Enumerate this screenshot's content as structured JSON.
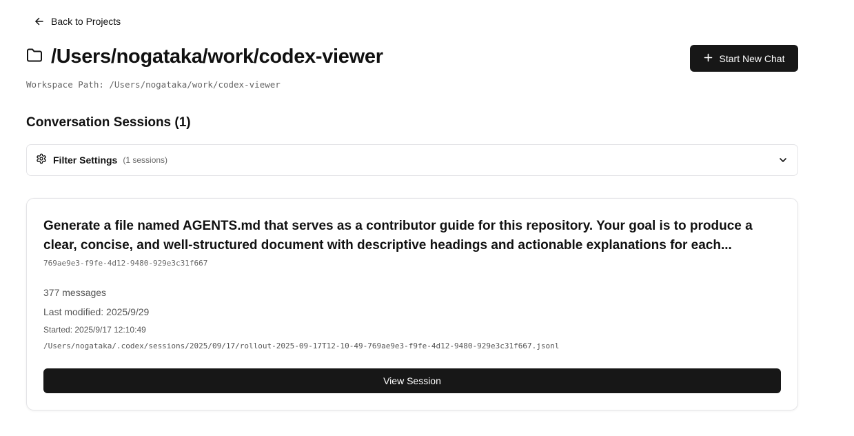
{
  "nav": {
    "back_label": "Back to Projects",
    "back_icon": "arrow-left-icon"
  },
  "header": {
    "folder_icon": "folder-icon",
    "title": "/Users/nogataka/work/codex-viewer",
    "workspace_path": "Workspace Path: /Users/nogataka/work/codex-viewer",
    "new_chat_label": "Start New Chat",
    "new_chat_icon": "plus-icon"
  },
  "sessions": {
    "heading": "Conversation Sessions (1)",
    "filter": {
      "icon": "gear-icon",
      "label": "Filter Settings",
      "count": "(1 sessions)",
      "toggle_icon": "chevron-down-icon"
    },
    "items": [
      {
        "title": "Generate a file named AGENTS.md that serves as a contributor guide for this repository. Your goal is to produce a clear, concise, and well-structured document with descriptive headings and actionable explanations for each...",
        "id": "769ae9e3-f9fe-4d12-9480-929e3c31f667",
        "messages": "377 messages",
        "last_modified": "Last modified: 2025/9/29",
        "started": "Started: 2025/9/17 12:10:49",
        "path": "/Users/nogataka/.codex/sessions/2025/09/17/rollout-2025-09-17T12-10-49-769ae9e3-f9fe-4d12-9480-929e3c31f667.jsonl",
        "action_label": "View Session"
      }
    ]
  },
  "colors": {
    "primary_button": "#171717",
    "border": "#e4e4e7",
    "muted_text": "#666666"
  }
}
